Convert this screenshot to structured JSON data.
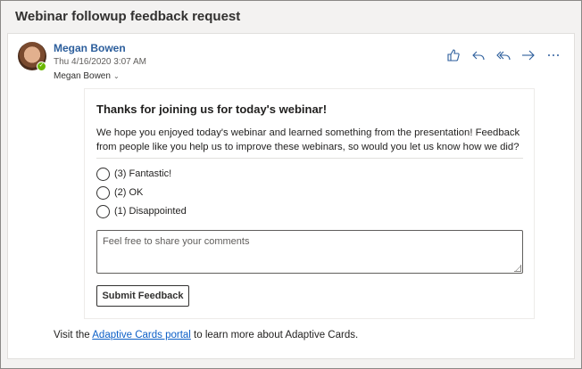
{
  "email": {
    "subject": "Webinar followup feedback request",
    "sender": "Megan Bowen",
    "sent": "Thu 4/16/2020 3:07 AM",
    "to": "Megan Bowen",
    "presence_color": "#6bb700",
    "actions": [
      {
        "name": "like",
        "icon": "thumbs-up-icon"
      },
      {
        "name": "reply",
        "icon": "reply-icon"
      },
      {
        "name": "reply-all",
        "icon": "reply-all-icon"
      },
      {
        "name": "forward",
        "icon": "forward-icon"
      },
      {
        "name": "more",
        "icon": "more-icon"
      }
    ]
  },
  "card": {
    "title": "Thanks for joining us for today's webinar!",
    "body": "We hope you enjoyed today's webinar and learned something from the presentation! Feedback from people like you help us to improve these webinars, so would you let us know how we did?",
    "choices": [
      {
        "label": "(3) Fantastic!"
      },
      {
        "label": "(2) OK"
      },
      {
        "label": "(1) Disappointed"
      }
    ],
    "comments_placeholder": "Feel free to share your comments",
    "submit_label": "Submit Feedback"
  },
  "footer": {
    "prefix": "Visit the ",
    "link_text": "Adaptive Cards portal",
    "suffix": " to learn more about Adaptive Cards."
  }
}
